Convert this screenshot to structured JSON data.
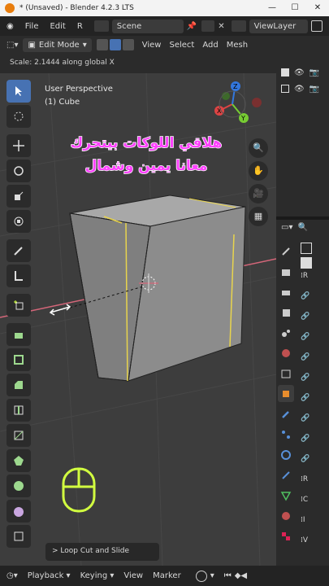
{
  "window": {
    "title": "* (Unsaved) - Blender 4.2.3 LTS",
    "min": "—",
    "max": "☐",
    "close": "✕"
  },
  "topbar": {
    "file": "File",
    "edit": "Edit",
    "r": "R",
    "scene": "Scene",
    "viewlayer": "ViewLayer"
  },
  "header": {
    "mode": "Edit Mode",
    "view": "View",
    "select": "Select",
    "add": "Add",
    "mesh": "Mesh"
  },
  "status": {
    "text": "Scale: 2.1444 along global X"
  },
  "viewport": {
    "perspective": "User Perspective",
    "object": "(1) Cube"
  },
  "overlay": {
    "line1": "هلاقي اللوكات بيتحرك",
    "line2": "معانا يمين وشمال"
  },
  "operator_panel": {
    "label": "Loop Cut and Slide",
    "chevron": ">"
  },
  "bottombar": {
    "playback": "Playback",
    "keying": "Keying",
    "view": "View",
    "marker": "Marker"
  },
  "gizmo": {
    "x": "X",
    "y": "Y",
    "z": "Z"
  },
  "props": {
    "r_labels": [
      "R",
      "R",
      "C",
      "I",
      "V"
    ]
  },
  "colors": {
    "accent": "#4772b3",
    "overlay_text": "#ff40ff",
    "cube_edge_select": "#e8d44d",
    "x_axis_line": "#d46679",
    "mouse_icon": "#d2ff40"
  }
}
